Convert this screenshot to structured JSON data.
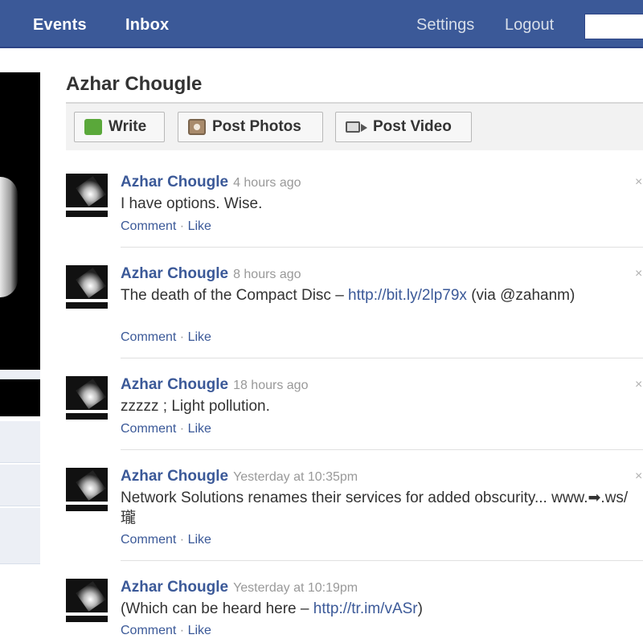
{
  "topbar": {
    "nav_items": [
      "Events",
      "Inbox"
    ],
    "right_items": [
      "Settings",
      "Logout"
    ],
    "search_value": ""
  },
  "profile": {
    "name": "Azhar Chougle"
  },
  "publisher": {
    "buttons": [
      {
        "label": "Write",
        "icon": "speech-bubble-icon"
      },
      {
        "label": "Post Photos",
        "icon": "photo-icon"
      },
      {
        "label": "Post Video",
        "icon": "video-camera-icon"
      }
    ]
  },
  "stories": [
    {
      "author": "Azhar Chougle",
      "time": "4 hours ago",
      "text": "I have options. Wise.",
      "link": "",
      "text_after": "",
      "comment": "Comment",
      "separator": " · ",
      "like": "Like"
    },
    {
      "author": "Azhar Chougle",
      "time": "8 hours ago",
      "text": "The death of the Compact Disc – ",
      "link": "http://bit.ly/2lp79x",
      "text_after": " (via @zahanm)",
      "comment": "Comment",
      "separator": " · ",
      "like": "Like"
    },
    {
      "author": "Azhar Chougle",
      "time": "18 hours ago",
      "text": "zzzzz ; Light pollution.",
      "link": "",
      "text_after": "",
      "comment": "Comment",
      "separator": " · ",
      "like": "Like"
    },
    {
      "author": "Azhar Chougle",
      "time": "Yesterday at 10:35pm",
      "text": "Network Solutions renames their services for added obscurity... www.➡.ws/瓏",
      "link": "",
      "text_after": "",
      "comment": "Comment",
      "separator": " · ",
      "like": "Like"
    },
    {
      "author": "Azhar Chougle",
      "time": "Yesterday at 10:19pm",
      "text": "(Which can be heard here – ",
      "link": "http://tr.im/vASr",
      "text_after": ")",
      "comment": "Comment",
      "separator": " · ",
      "like": "Like"
    }
  ],
  "colors": {
    "brand": "#3b5998",
    "link": "#3b5998",
    "timestamp": "#999999"
  }
}
